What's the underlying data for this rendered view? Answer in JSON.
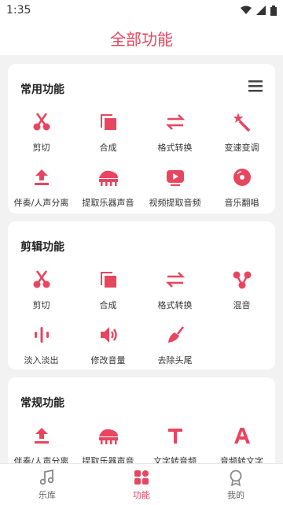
{
  "status": {
    "time": "1:35"
  },
  "header": {
    "title": "全部功能"
  },
  "colors": {
    "accent": "#e8455f",
    "background": "#f2f2f2"
  },
  "sections": [
    {
      "title": "常用功能",
      "has_menu": true,
      "items": [
        {
          "label": "剪切",
          "icon": "scissors-icon"
        },
        {
          "label": "合成",
          "icon": "merge-icon"
        },
        {
          "label": "格式转换",
          "icon": "convert-icon"
        },
        {
          "label": "变速变调",
          "icon": "magic-wand-icon"
        },
        {
          "label": "伴奏/人声分离",
          "icon": "upload-arrow-icon"
        },
        {
          "label": "提取乐器声音",
          "icon": "piano-icon"
        },
        {
          "label": "视频提取音频",
          "icon": "video-play-icon"
        },
        {
          "label": "音乐翻唱",
          "icon": "record-icon"
        }
      ]
    },
    {
      "title": "剪辑功能",
      "items": [
        {
          "label": "剪切",
          "icon": "scissors-icon"
        },
        {
          "label": "合成",
          "icon": "merge-icon"
        },
        {
          "label": "格式转换",
          "icon": "convert-icon"
        },
        {
          "label": "混音",
          "icon": "mix-icon"
        },
        {
          "label": "淡入淡出",
          "icon": "waveform-icon"
        },
        {
          "label": "修改音量",
          "icon": "volume-icon"
        },
        {
          "label": "去除头尾",
          "icon": "broom-icon"
        }
      ]
    },
    {
      "title": "常规功能",
      "items": [
        {
          "label": "伴奏/人声分离",
          "icon": "upload-arrow-icon"
        },
        {
          "label": "提取乐器声音",
          "icon": "piano-icon"
        },
        {
          "label": "文字转音频",
          "icon": "text-t-icon"
        },
        {
          "label": "音频转文字",
          "icon": "text-a-icon"
        }
      ]
    }
  ],
  "bottom_nav": [
    {
      "label": "乐库",
      "icon": "music-note-icon",
      "active": false
    },
    {
      "label": "功能",
      "icon": "grid-icon",
      "active": true
    },
    {
      "label": "我的",
      "icon": "profile-icon",
      "active": false
    }
  ]
}
